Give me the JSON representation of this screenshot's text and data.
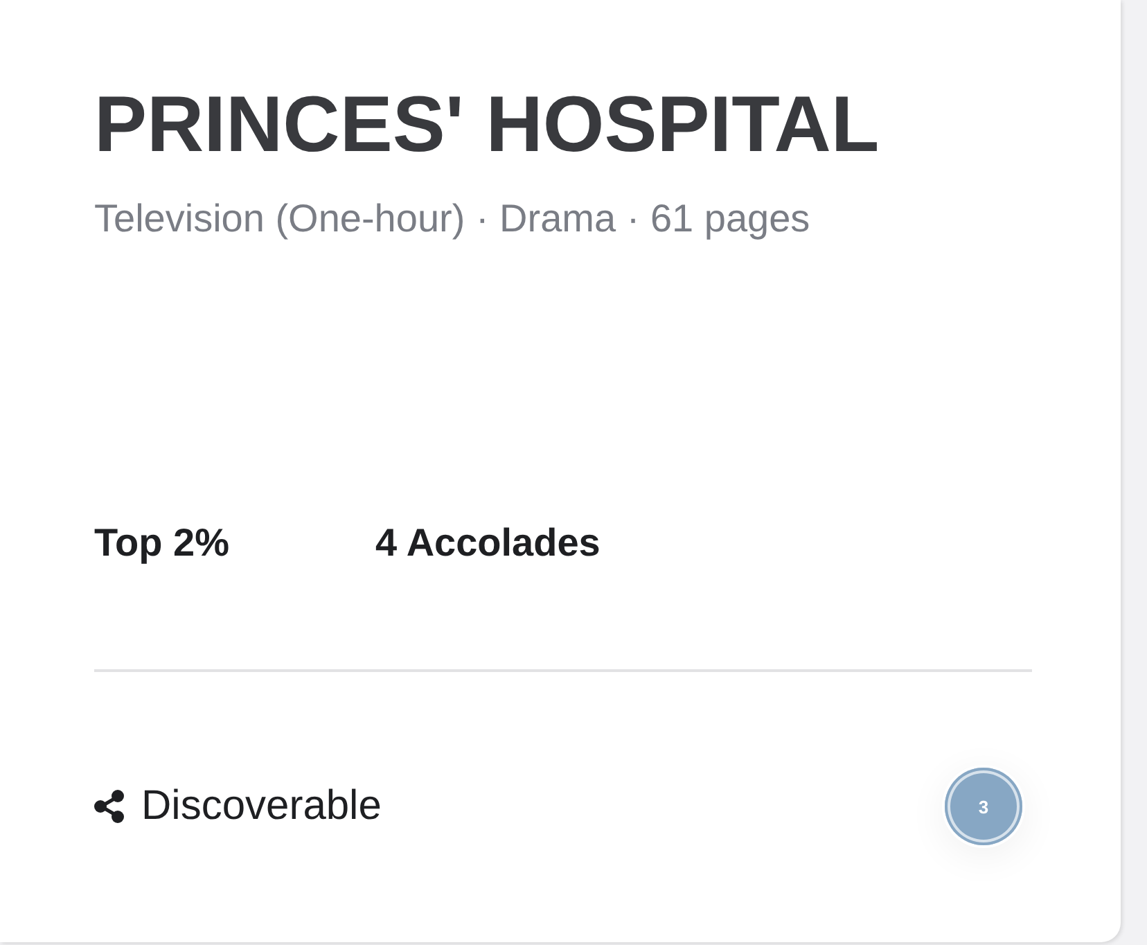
{
  "card": {
    "title": "PRINCES' HOSPITAL",
    "subtitle": "Television (One-hour) · Drama · 61 pages",
    "stats": [
      "Top 2%",
      "4 Accolades"
    ],
    "visibility": {
      "label": "Discoverable"
    }
  },
  "badge": {
    "count": "3"
  }
}
